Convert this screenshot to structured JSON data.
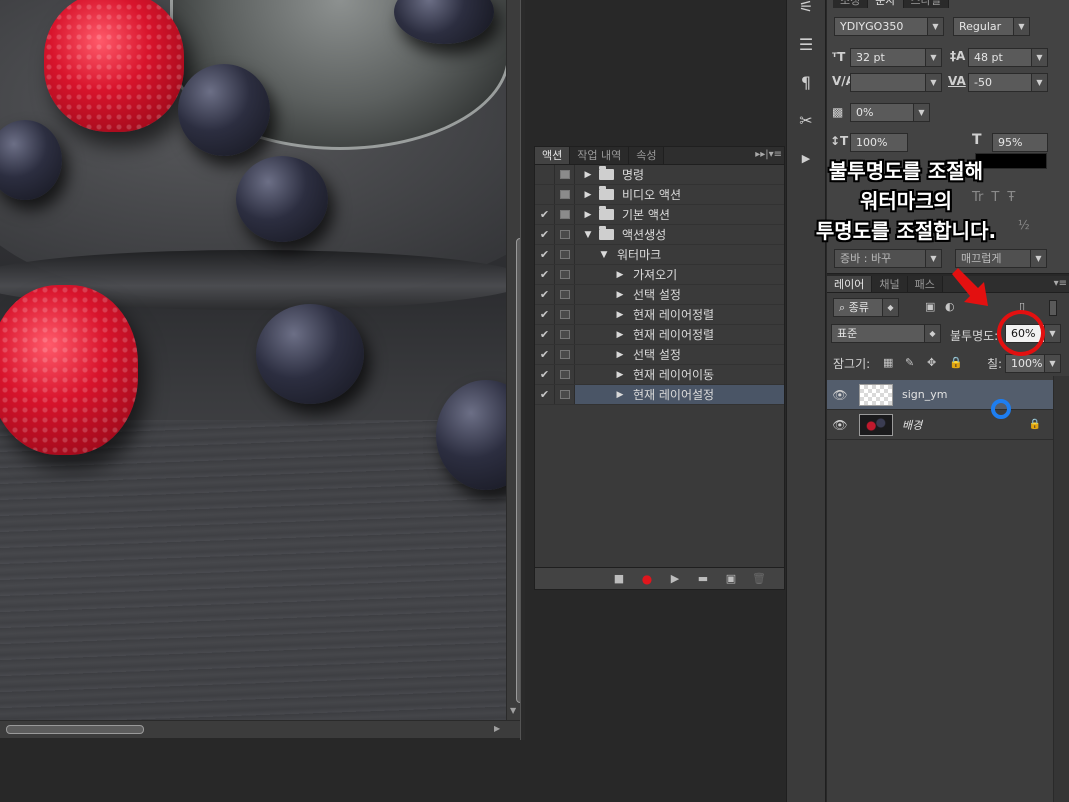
{
  "actions_panel": {
    "tabs": [
      "액션",
      "작업 내역",
      "속성"
    ],
    "menu_glyph": "▸▸|▾≡",
    "rows": [
      {
        "label": "명령",
        "checked": "",
        "level": 0,
        "expanded": false,
        "folder": true,
        "dialog": "filled",
        "selected": false
      },
      {
        "label": "비디오 액션",
        "checked": "",
        "level": 0,
        "expanded": false,
        "folder": true,
        "dialog": "filled",
        "selected": false
      },
      {
        "label": "기본 액션",
        "checked": "✔",
        "level": 0,
        "expanded": false,
        "folder": true,
        "dialog": "filled",
        "selected": false
      },
      {
        "label": "액션생성",
        "checked": "✔",
        "level": 0,
        "expanded": true,
        "folder": true,
        "dialog": "empty",
        "selected": false
      },
      {
        "label": "워터마크",
        "checked": "✔",
        "level": 1,
        "expanded": true,
        "folder": false,
        "dialog": "empty",
        "selected": false
      },
      {
        "label": "가져오기",
        "checked": "✔",
        "level": 2,
        "expanded": false,
        "folder": false,
        "dialog": "empty",
        "selected": false
      },
      {
        "label": "선택 설정",
        "checked": "✔",
        "level": 2,
        "expanded": false,
        "folder": false,
        "dialog": "empty",
        "selected": false
      },
      {
        "label": "현재 레이어정렬",
        "checked": "✔",
        "level": 2,
        "expanded": false,
        "folder": false,
        "dialog": "empty",
        "selected": false
      },
      {
        "label": "현재 레이어정렬",
        "checked": "✔",
        "level": 2,
        "expanded": false,
        "folder": false,
        "dialog": "empty",
        "selected": false
      },
      {
        "label": "선택 설정",
        "checked": "✔",
        "level": 2,
        "expanded": false,
        "folder": false,
        "dialog": "empty",
        "selected": false
      },
      {
        "label": "현재 레이어이동",
        "checked": "✔",
        "level": 2,
        "expanded": false,
        "folder": false,
        "dialog": "empty",
        "selected": false
      },
      {
        "label": "현재 레이어설정",
        "checked": "✔",
        "level": 2,
        "expanded": false,
        "folder": false,
        "dialog": "empty",
        "selected": true
      }
    ],
    "footer_buttons": [
      "stop",
      "record",
      "play",
      "new-set",
      "new-action",
      "delete"
    ]
  },
  "character_panel": {
    "tabs": [
      "조정",
      "문자",
      "스타일"
    ],
    "font_family": "YDIYGO350",
    "font_style": "Regular",
    "font_size": "32 pt",
    "leading": "48 pt",
    "kerning": "",
    "tracking": "-50",
    "tsume": "0%",
    "vertical_scale": "100%",
    "horizontal_scale": "95%",
    "color": "#000000",
    "partial_label_left": "증바 : 바꾸",
    "partial_label_right": "매끄럽게"
  },
  "layers_panel": {
    "tabs": [
      "레이어",
      "채널",
      "패스"
    ],
    "filter_kind": "종류",
    "blend_mode": "표준",
    "opacity_label": "불투명도:",
    "opacity_value": "60%",
    "lock_label": "잠그기:",
    "fill_label": "칠:",
    "fill_value": "100%",
    "layers": [
      {
        "name": "sign_ym",
        "type": "transparent",
        "visible": true,
        "selected": true,
        "locked": false,
        "italic": false
      },
      {
        "name": "배경",
        "type": "photo",
        "visible": true,
        "selected": false,
        "locked": true,
        "italic": true
      }
    ]
  },
  "annotation": {
    "lines": [
      "불투명도를 조절해",
      "워터마크의",
      "투명도를 조절합니다."
    ],
    "arrow_color": "#e31010",
    "ring_color": "#e31010",
    "cursor_color": "#1e7ef0"
  },
  "colors": {
    "panel_bg": "#3a3a3a",
    "selection_bg": "#4a5566",
    "record_red": "#e0161d"
  }
}
